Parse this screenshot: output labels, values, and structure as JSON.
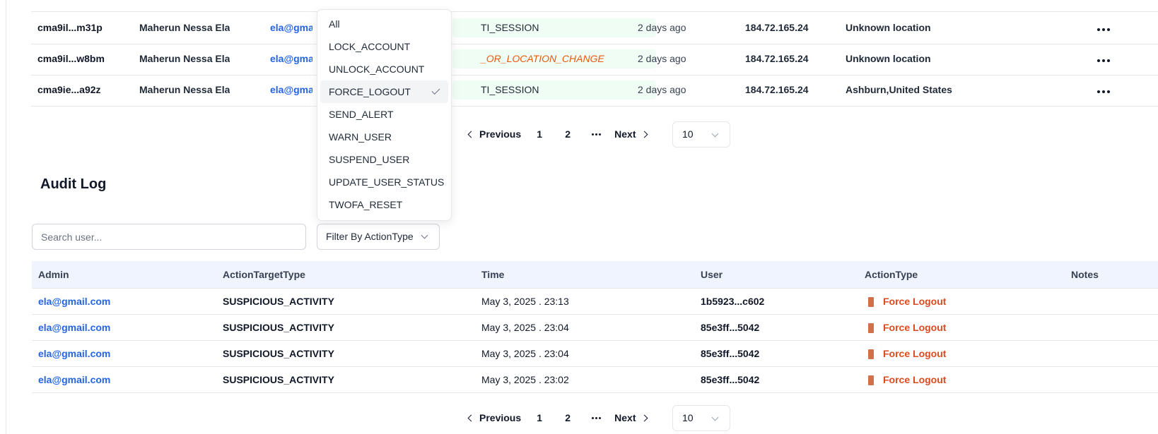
{
  "sessions": {
    "rows": [
      {
        "id": "cma9il...m31p",
        "name": "Maherun Nessa Ela",
        "email": "ela@gmai",
        "action": "TI_SESSION",
        "action_style": "normal",
        "ago": "2 days ago",
        "ip": "184.72.165.24",
        "location": "Unknown location",
        "more_icon": "more-horizontal-icon"
      },
      {
        "id": "cma9il...w8bm",
        "name": "Maherun Nessa Ela",
        "email": "ela@gmai",
        "action": "_OR_LOCATION_CHANGE",
        "action_style": "warn",
        "ago": "2 days ago",
        "ip": "184.72.165.24",
        "location": "Unknown location",
        "more_icon": "more-horizontal-icon"
      },
      {
        "id": "cma9ie...a92z",
        "name": "Maherun Nessa Ela",
        "email": "ela@gmai",
        "action": "TI_SESSION",
        "action_style": "normal",
        "ago": "2 days ago",
        "ip": "184.72.165.24",
        "location": "Ashburn,United States",
        "more_icon": "more-horizontal-icon"
      }
    ],
    "pagination": {
      "previous": "Previous",
      "pages": [
        "1",
        "2"
      ],
      "next": "Next",
      "page_size": "10"
    }
  },
  "audit": {
    "title": "Audit Log",
    "search_placeholder": "Search user...",
    "filter_label": "Filter By ActionType",
    "columns": [
      "Admin",
      "ActionTargetType",
      "Time",
      "User",
      "ActionType",
      "Notes"
    ],
    "rows": [
      {
        "admin": "ela@gmail.com",
        "target": "SUSPICIOUS_ACTIVITY",
        "time": "May 3, 2025 . 23:13",
        "user": "1b5923...c602",
        "action": "Force Logout",
        "notes": ""
      },
      {
        "admin": "ela@gmail.com",
        "target": "SUSPICIOUS_ACTIVITY",
        "time": "May 3, 2025 . 23:04",
        "user": "85e3ff...5042",
        "action": "Force Logout",
        "notes": ""
      },
      {
        "admin": "ela@gmail.com",
        "target": "SUSPICIOUS_ACTIVITY",
        "time": "May 3, 2025 . 23:04",
        "user": "85e3ff...5042",
        "action": "Force Logout",
        "notes": ""
      },
      {
        "admin": "ela@gmail.com",
        "target": "SUSPICIOUS_ACTIVITY",
        "time": "May 3, 2025 . 23:02",
        "user": "85e3ff...5042",
        "action": "Force Logout",
        "notes": ""
      }
    ],
    "pagination": {
      "previous": "Previous",
      "pages": [
        "1",
        "2"
      ],
      "next": "Next",
      "page_size": "10"
    }
  },
  "dropdown": {
    "options": [
      "All",
      "LOCK_ACCOUNT",
      "UNLOCK_ACCOUNT",
      "FORCE_LOGOUT",
      "SEND_ALERT",
      "WARN_USER",
      "SUSPEND_USER",
      "UPDATE_USER_STATUS",
      "TWOFA_RESET"
    ],
    "selected": "FORCE_LOGOUT"
  },
  "colors": {
    "link": "#2563eb",
    "action_danger": "#dc4a1e",
    "warn_text": "#ea580c",
    "pill_bg": "#f0fdf4",
    "table_head_bg": "#eff4ff"
  }
}
